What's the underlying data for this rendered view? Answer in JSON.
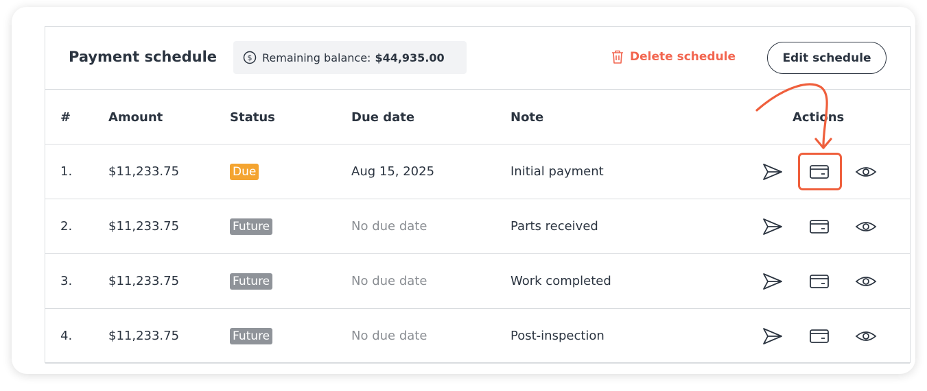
{
  "header": {
    "title": "Payment schedule",
    "balance_label": "Remaining balance:",
    "balance_value": "$44,935.00",
    "delete_label": "Delete schedule",
    "edit_label": "Edit schedule"
  },
  "table": {
    "columns": [
      "#",
      "Amount",
      "Status",
      "Due date",
      "Note",
      "Actions"
    ],
    "rows": [
      {
        "num": "1.",
        "amount": "$11,233.75",
        "status": "Due",
        "due_date": "Aug 15, 2025",
        "note": "Initial payment"
      },
      {
        "num": "2.",
        "amount": "$11,233.75",
        "status": "Future",
        "due_date": "No due date",
        "note": "Parts received"
      },
      {
        "num": "3.",
        "amount": "$11,233.75",
        "status": "Future",
        "due_date": "No due date",
        "note": "Work completed"
      },
      {
        "num": "4.",
        "amount": "$11,233.75",
        "status": "Future",
        "due_date": "No due date",
        "note": "Post-inspection"
      }
    ]
  },
  "icons": {
    "balance": "dollar-coin-icon",
    "delete": "trash-icon",
    "send": "send-icon",
    "pay": "credit-card-icon",
    "view": "eye-icon"
  },
  "colors": {
    "accent": "#f2654f",
    "due_badge": "#f4a430",
    "future_badge": "#8f9399",
    "annotation": "#ef5f3c"
  }
}
